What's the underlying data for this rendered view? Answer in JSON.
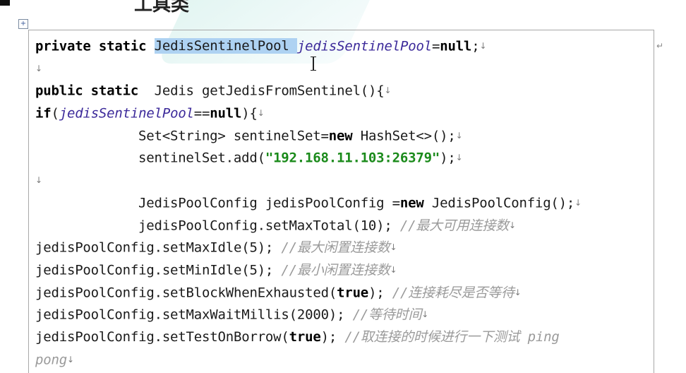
{
  "heading_partial": "工具类",
  "handle_glyph": "+",
  "para_mark": "↵",
  "ret": "↓",
  "code": {
    "l1": {
      "kw": "private static ",
      "sel": "JedisSentinelPool ",
      "it": "jedisSentinelPool",
      "eq": "=",
      "nul": "null",
      "semi": ";"
    },
    "l3": {
      "kw": "public static ",
      "rest": " Jedis getJedisFromSentinel(){"
    },
    "l4": {
      "kw": "if",
      "open": "(",
      "it": "jedisSentinelPool",
      "eq": "==",
      "nul": "null",
      "close": "){"
    },
    "l5": {
      "a": "Set<String> sentinelSet=",
      "kw": "new",
      "b": " HashSet<>();"
    },
    "l6": {
      "a": "sentinelSet.add(",
      "str": "\"192.168.11.103:26379\"",
      "b": ");"
    },
    "l8": {
      "a": "JedisPoolConfig jedisPoolConfig =",
      "kw": "new",
      "b": " JedisPoolConfig();"
    },
    "l9": {
      "a": "jedisPoolConfig.setMaxTotal(10); ",
      "cm": "//最大可用连接数"
    },
    "l10": {
      "a": "jedisPoolConfig.setMaxIdle(5); ",
      "cm": "//最大闲置连接数"
    },
    "l11": {
      "a": "jedisPoolConfig.setMinIdle(5); ",
      "cm": "//最小闲置连接数"
    },
    "l12": {
      "a": "jedisPoolConfig.setBlockWhenExhausted(",
      "kw": "true",
      "b": "); ",
      "cm": "//连接耗尽是否等待"
    },
    "l13": {
      "a": "jedisPoolConfig.setMaxWaitMillis(2000); ",
      "cm": "//等待时间"
    },
    "l14": {
      "a": "jedisPoolConfig.setTestOnBorrow(",
      "kw": "true",
      "b": "); ",
      "cm": "//取连接的时候进行一下测试 ping"
    },
    "l15": {
      "cm": "pong"
    }
  }
}
